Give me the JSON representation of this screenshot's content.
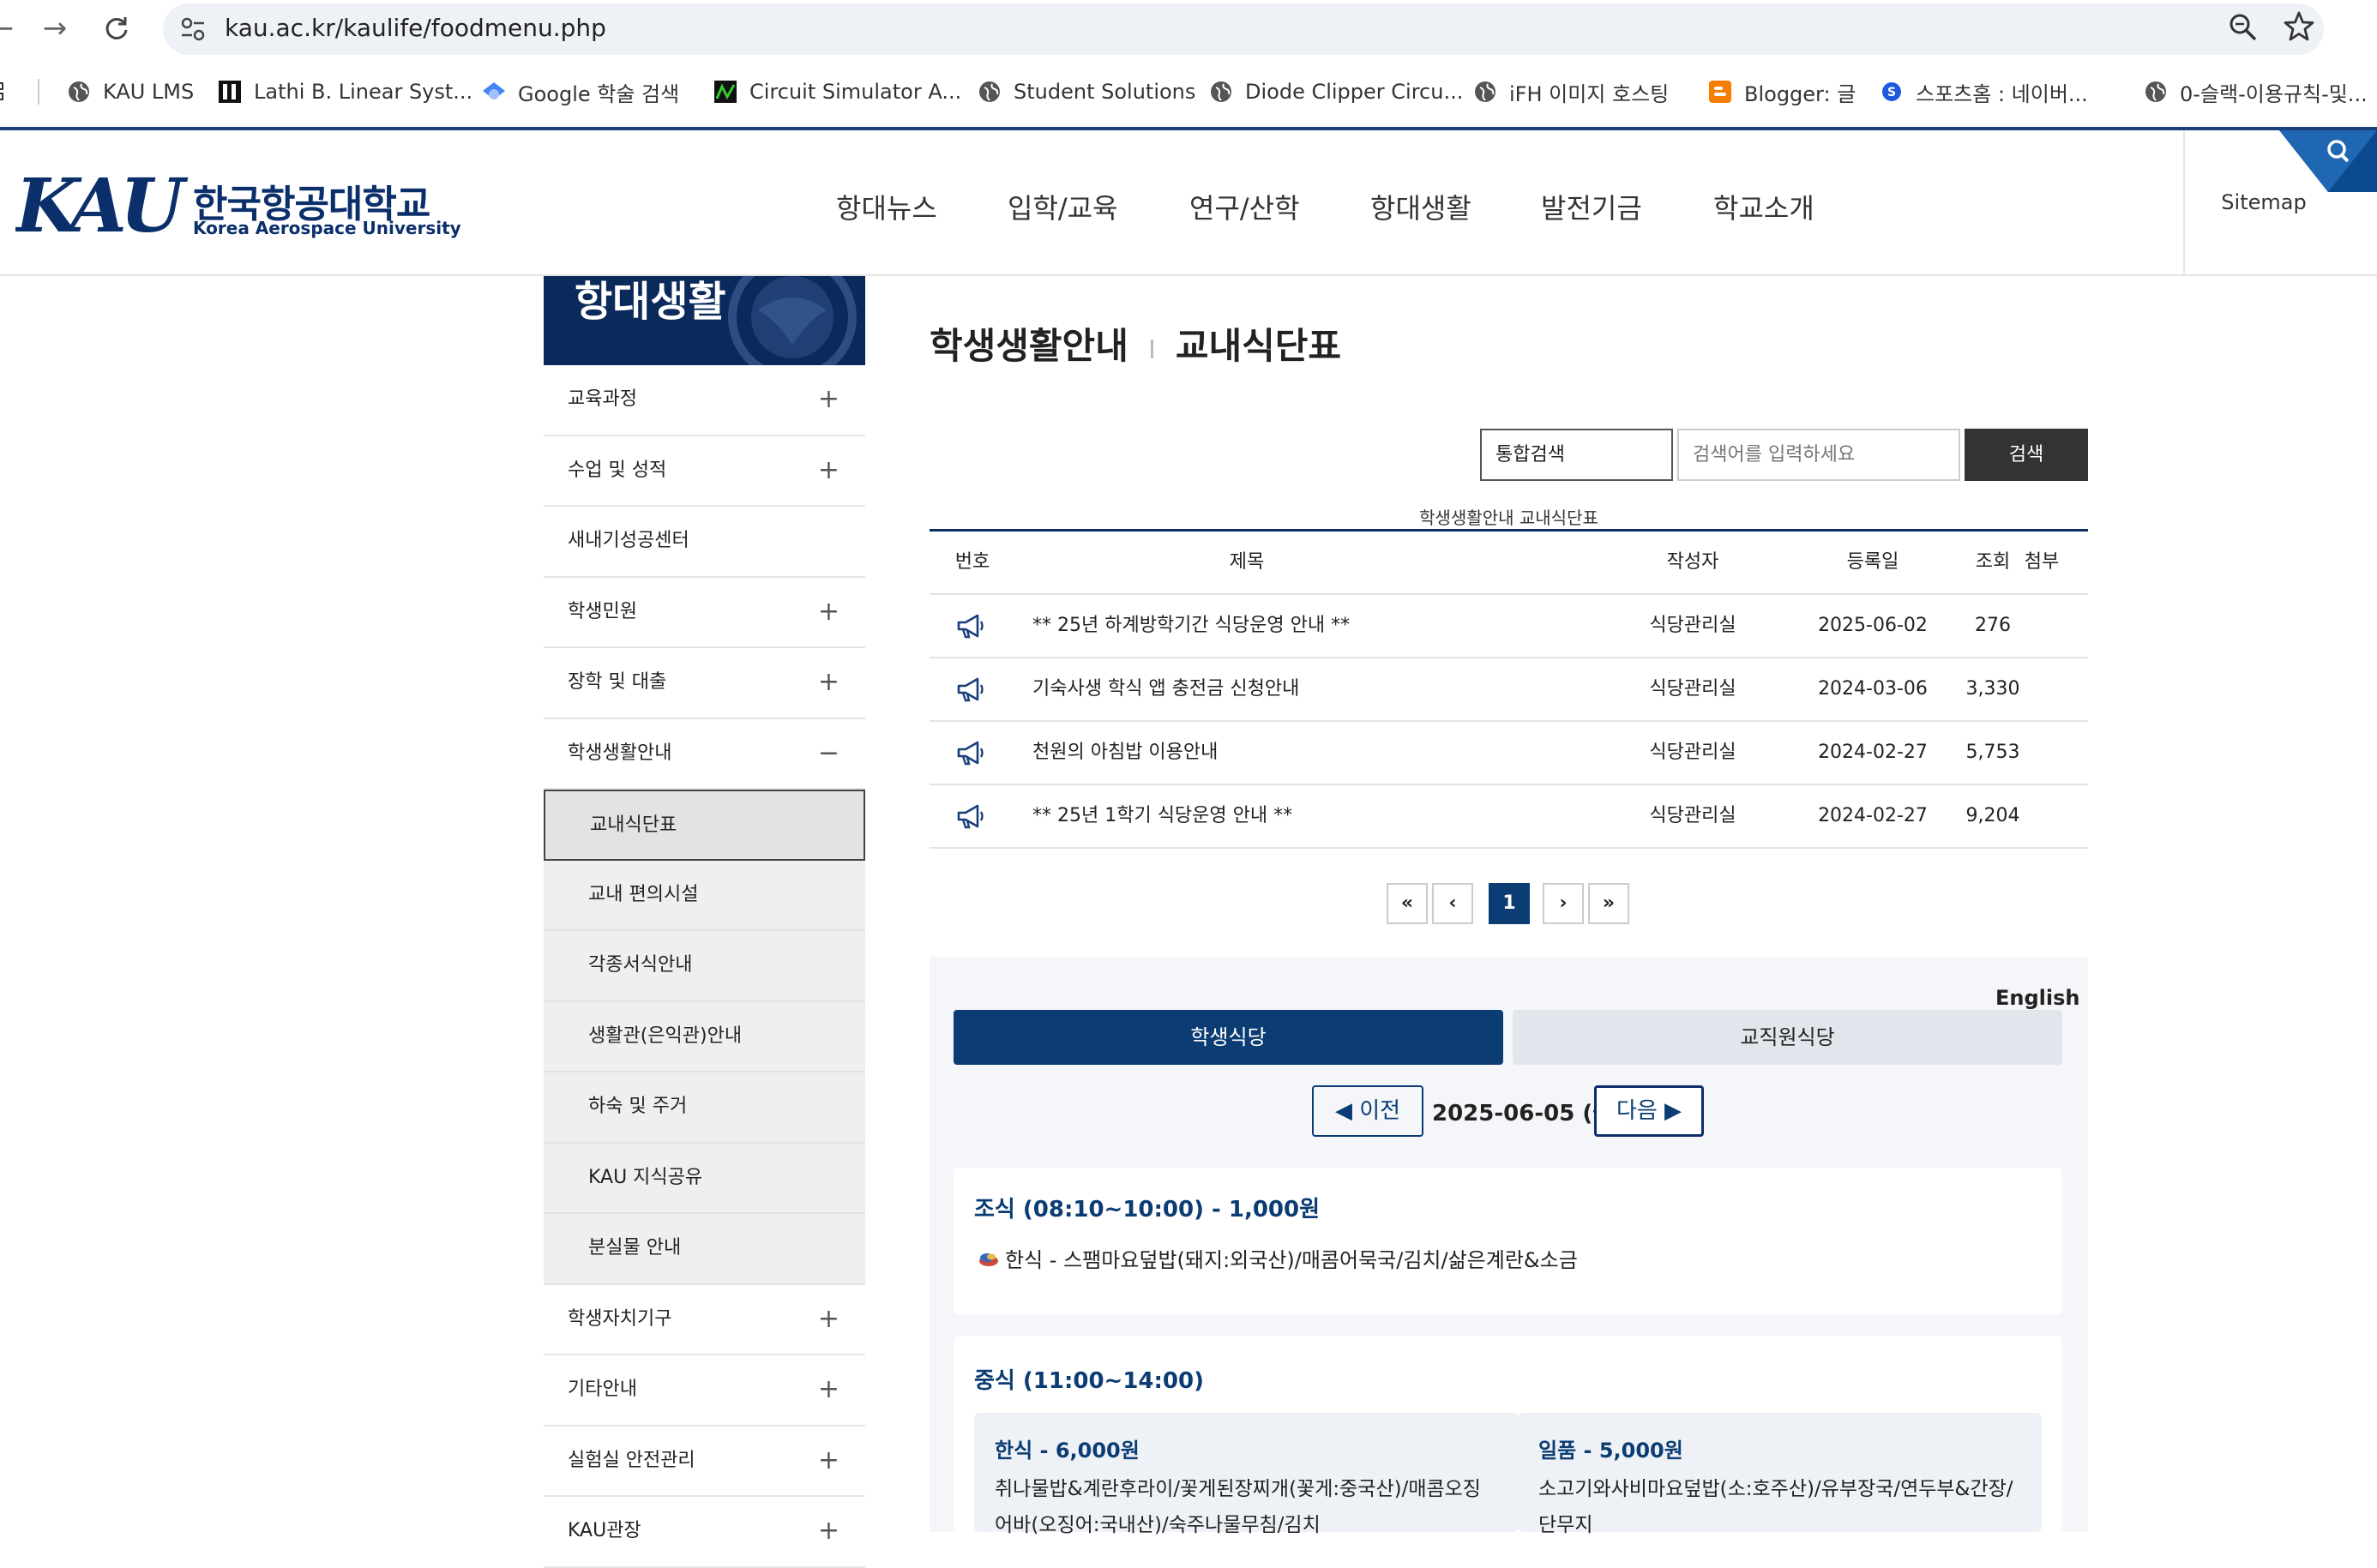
{
  "browser": {
    "url": "kau.ac.kr/kaulife/foodmenu.php",
    "bookmarks": [
      "KAU LMS",
      "Lathi B. Linear Syst...",
      "Google 학술 검색",
      "Circuit Simulator A...",
      "Student Solutions",
      "Diode Clipper Circu...",
      "iFH 이미지 호스팅",
      "Blogger: 글",
      "스포츠홈 : 네이버...",
      "0-슬랙-이용규칙-및..."
    ]
  },
  "header": {
    "logo_text": "KAU",
    "logo_ko": "한국항공대학교",
    "logo_en": "Korea Aerospace University",
    "nav": [
      "항대뉴스",
      "입학/교육",
      "연구/산학",
      "항대생활",
      "발전기금",
      "학교소개"
    ],
    "sitemap": "Sitemap"
  },
  "sidebar": {
    "title": "항대생활",
    "items": [
      {
        "label": "교육과정",
        "toggle": "+"
      },
      {
        "label": "수업 및 성적",
        "toggle": "+"
      },
      {
        "label": "새내기성공센터",
        "toggle": ""
      },
      {
        "label": "학생민원",
        "toggle": "+"
      },
      {
        "label": "장학 및 대출",
        "toggle": "+"
      },
      {
        "label": "학생생활안내",
        "toggle": "−"
      }
    ],
    "sub_items": [
      "교내식단표",
      "교내 편의시설",
      "각종서식안내",
      "생활관(은익관)안내",
      "하숙 및 주거",
      "KAU 지식공유",
      "분실물 안내"
    ],
    "items_after": [
      {
        "label": "학생자치기구",
        "toggle": "+"
      },
      {
        "label": "기타안내",
        "toggle": "+"
      },
      {
        "label": "실험실 안전관리",
        "toggle": "+"
      },
      {
        "label": "KAU관장",
        "toggle": "+"
      }
    ]
  },
  "page": {
    "breadcrumb_parent": "학생생활안내",
    "title": "교내식단표"
  },
  "search": {
    "scope": "통합검색",
    "placeholder": "검색어를 입력하세요",
    "button": "검색"
  },
  "board": {
    "caption": "학생생활안내 교내식단표",
    "columns": [
      "번호",
      "제목",
      "작성자",
      "등록일",
      "조회",
      "첨부"
    ],
    "rows": [
      {
        "title": "** 25년 하계방학기간 식당운영 안내 **",
        "writer": "식당관리실",
        "date": "2025-06-02",
        "views": "276"
      },
      {
        "title": "기숙사생 학식 앱 충전금 신청안내",
        "writer": "식당관리실",
        "date": "2024-03-06",
        "views": "3,330"
      },
      {
        "title": "천원의 아침밥 이용안내",
        "writer": "식당관리실",
        "date": "2024-02-27",
        "views": "5,753"
      },
      {
        "title": "** 25년 1학기 식당운영 안내 **",
        "writer": "식당관리실",
        "date": "2024-02-27",
        "views": "9,204"
      }
    ]
  },
  "pagination": {
    "first": "«",
    "prev": "‹",
    "current": "1",
    "next": "›",
    "last": "»"
  },
  "meal": {
    "english": "English",
    "tabs": [
      "학생식당",
      "교직원식당"
    ],
    "prev": "◀ 이전",
    "date": "2025-06-05 (금)",
    "next": "다음 ▶",
    "breakfast": {
      "title": "조식 (08:10~10:00) - 1,000원",
      "menu": "한식 - 스팸마요덮밥(돼지:외국산)/매콤어묵국/김치/삶은계란&소금"
    },
    "lunch": {
      "title": "중식 (11:00~14:00)",
      "korean": {
        "title": "한식 - 6,000원",
        "menu": "취나물밥&계란후라이/꽃게된장찌개(꽃게:중국산)/매콤오징어바(오징어:국내산)/숙주나물무침/김치"
      },
      "single": {
        "title": "일품 - 5,000원",
        "menu": "소고기와사비마요덮밥(소:호주산)/유부장국/연두부&간장/단무지"
      }
    }
  }
}
